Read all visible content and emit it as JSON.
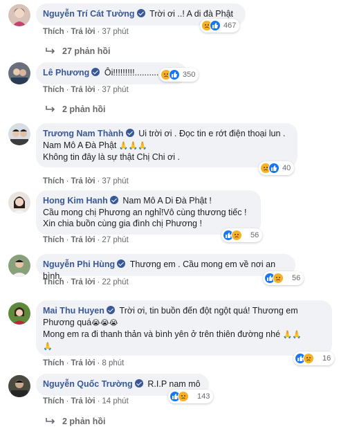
{
  "actions": {
    "like": "Thích",
    "reply": "Trả lời",
    "sep": "·"
  },
  "comments": [
    {
      "name": "Nguyễn Trí Cát Tường",
      "lines": [
        "Trời ơi ..! A di đà Phật"
      ],
      "reaction_count": "467",
      "time": "37 phút",
      "replies": "27 phản hồi"
    },
    {
      "name": "Lê Phương",
      "lines": [
        "Ôi!!!!!!!!!.........."
      ],
      "reaction_count": "350",
      "time": "37 phút",
      "replies": "2 phản hồi"
    },
    {
      "name": "Trương Nam Thành",
      "lines": [
        "Ui trời ơi . Đọc tin e rớt điện thoại lun .",
        "Nam Mô A Đà Phật",
        "Không tin đây là sự thật Chị Chi ơi ."
      ],
      "reaction_count": "40",
      "time": "37 phút"
    },
    {
      "name": "Hong Kim Hanh",
      "lines": [
        "Nam Mô A Di Đà Phật !",
        "Cầu mong chị Phương an nghỉ!Vô cùng thương tiếc !",
        "Xin chia buồn cùng gia đình chị Phương !"
      ],
      "reaction_count": "56",
      "time": "27 phút"
    },
    {
      "name": "Nguyễn Phi Hùng",
      "lines": [
        "Thương em . Cầu mong em về nơi an bình."
      ],
      "reaction_count": "56",
      "time": "22 phút"
    },
    {
      "name": "Mai Thu Huyen",
      "lines": [
        "Trời ơi, tin buồn đến đột ngột quá! Thương em",
        "Phương quá",
        "Mong em ra đi thanh thản và bình yên ở trên thiên đường nhé"
      ],
      "reaction_count": "16",
      "time": "8 phút"
    },
    {
      "name": "Nguyễn Quốc Trường",
      "lines": [
        "R.I.P nam mô"
      ],
      "reaction_count": "143",
      "time": "14 phút",
      "replies": "2 phản hồi"
    }
  ],
  "icons": {
    "verified": "verified-badge-icon",
    "like": "like-reaction-icon",
    "sad": "sad-reaction-icon",
    "reply_arrow": "reply-arrow-icon",
    "pray": "folded-hands-emoji",
    "cry": "crying-face-emoji"
  },
  "colors": {
    "name": "#385898",
    "bubble": "#f0f2f5",
    "meta": "#65676b",
    "like": "#1877f2",
    "sad": "#f7b125"
  }
}
